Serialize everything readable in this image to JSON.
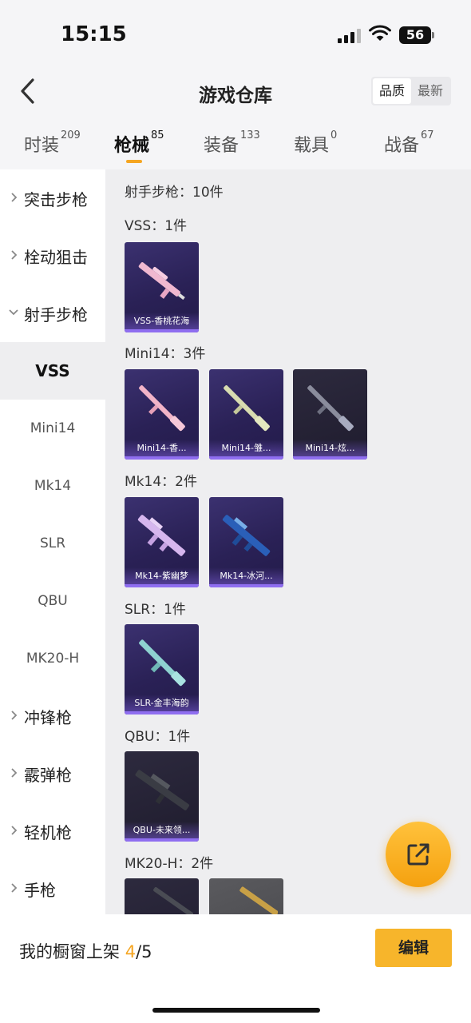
{
  "status_bar": {
    "time": "15:15",
    "battery": "56"
  },
  "header": {
    "title": "游戏仓库",
    "sort_options": [
      "品质",
      "最新"
    ]
  },
  "tabs": [
    {
      "label": "时装",
      "count": "209"
    },
    {
      "label": "枪械",
      "count": "85"
    },
    {
      "label": "装备",
      "count": "133"
    },
    {
      "label": "载具",
      "count": "0"
    },
    {
      "label": "战备",
      "count": "67"
    }
  ],
  "sidebar": {
    "items": [
      {
        "label": "突击步枪"
      },
      {
        "label": "栓动狙击"
      },
      {
        "label": "射手步枪"
      },
      {
        "label": "VSS"
      },
      {
        "label": "Mini14"
      },
      {
        "label": "Mk14"
      },
      {
        "label": "SLR"
      },
      {
        "label": "QBU"
      },
      {
        "label": "MK20-H"
      },
      {
        "label": "冲锋枪"
      },
      {
        "label": "霰弹枪"
      },
      {
        "label": "轻机枪"
      },
      {
        "label": "手枪"
      }
    ]
  },
  "content": {
    "summary": "射手步枪：10件",
    "groups": [
      {
        "title": "VSS：1件",
        "items": [
          {
            "name": "VSS-香桃花海"
          }
        ]
      },
      {
        "title": "Mini14：3件",
        "items": [
          {
            "name": "Mini14-香..."
          },
          {
            "name": "Mini14-雏..."
          },
          {
            "name": "Mini14-炫..."
          }
        ]
      },
      {
        "title": "Mk14：2件",
        "items": [
          {
            "name": "Mk14-紫幽梦"
          },
          {
            "name": "Mk14-冰河..."
          }
        ]
      },
      {
        "title": "SLR：1件",
        "items": [
          {
            "name": "SLR-金丰海韵"
          }
        ]
      },
      {
        "title": "QBU：1件",
        "items": [
          {
            "name": "QBU-未来领..."
          }
        ]
      },
      {
        "title": "MK20-H：2件",
        "items": []
      }
    ]
  },
  "bottom": {
    "shelf_label": "我的橱窗上架",
    "shelf_current": "4",
    "shelf_total": "/5",
    "edit_label": "编辑"
  },
  "colors": {
    "accent": "#f5a623",
    "card_purple": "#2a2156",
    "card_bar": "#8f6ef0"
  }
}
